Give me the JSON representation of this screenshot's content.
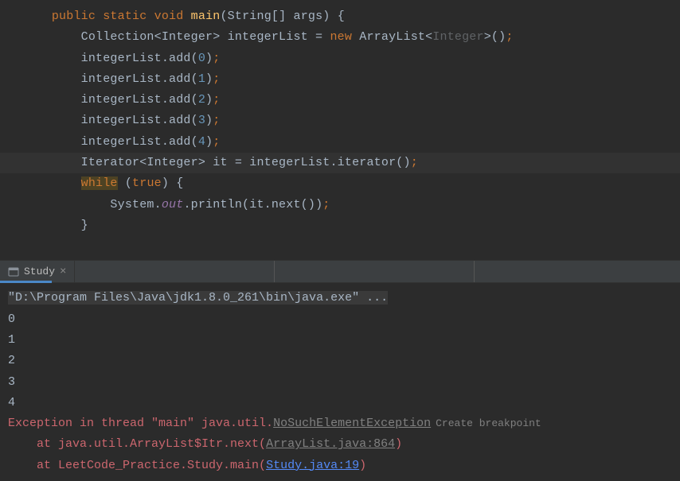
{
  "code": {
    "line1": {
      "public": "public",
      "static": "static",
      "void": "void",
      "main": "main",
      "params": "(String[] args) {"
    },
    "line2": {
      "pre": "        Collection<Integer> integerList = ",
      "new": "new",
      "post1": " ArrayList<",
      "generic": "Integer",
      "post2": ">()",
      "semi": ";"
    },
    "line3": {
      "pre": "        integerList.add(",
      "num": "0",
      "post": ")",
      "semi": ";"
    },
    "line4": {
      "pre": "        integerList.add(",
      "num": "1",
      "post": ")",
      "semi": ";"
    },
    "line5": {
      "pre": "        integerList.add(",
      "num": "2",
      "post": ")",
      "semi": ";"
    },
    "line6": {
      "pre": "        integerList.add(",
      "num": "3",
      "post": ")",
      "semi": ";"
    },
    "line7": {
      "pre": "        integerList.add(",
      "num": "4",
      "post": ")",
      "semi": ";"
    },
    "line8": {
      "text": "        Iterator<Integer> it = integerList.iterator()",
      "semi": ";"
    },
    "line9": {
      "pre": "        ",
      "while": "while",
      "mid": " (",
      "true": "true",
      "post": ") {"
    },
    "line10": {
      "pre": "            System.",
      "out": "out",
      "post": ".println(it.next())",
      "semi": ";"
    },
    "line11": {
      "text": "        }"
    }
  },
  "tab": {
    "name": "Study"
  },
  "console": {
    "cmd": "\"D:\\Program Files\\Java\\jdk1.8.0_261\\bin\\java.exe\" ...",
    "out0": "0",
    "out1": "1",
    "out2": "2",
    "out3": "3",
    "out4": "4",
    "exc_pre": "Exception in thread \"main\" java.util.",
    "exc_name": "NoSuchElementException",
    "create_bp": "Create breakpoint",
    "at1_pre": "    at java.util.ArrayList$Itr.next(",
    "at1_link": "ArrayList.java:864",
    "at1_post": ")",
    "at2_pre": "    at LeetCode_Practice.Study.main(",
    "at2_link": "Study.java:19",
    "at2_post": ")"
  }
}
